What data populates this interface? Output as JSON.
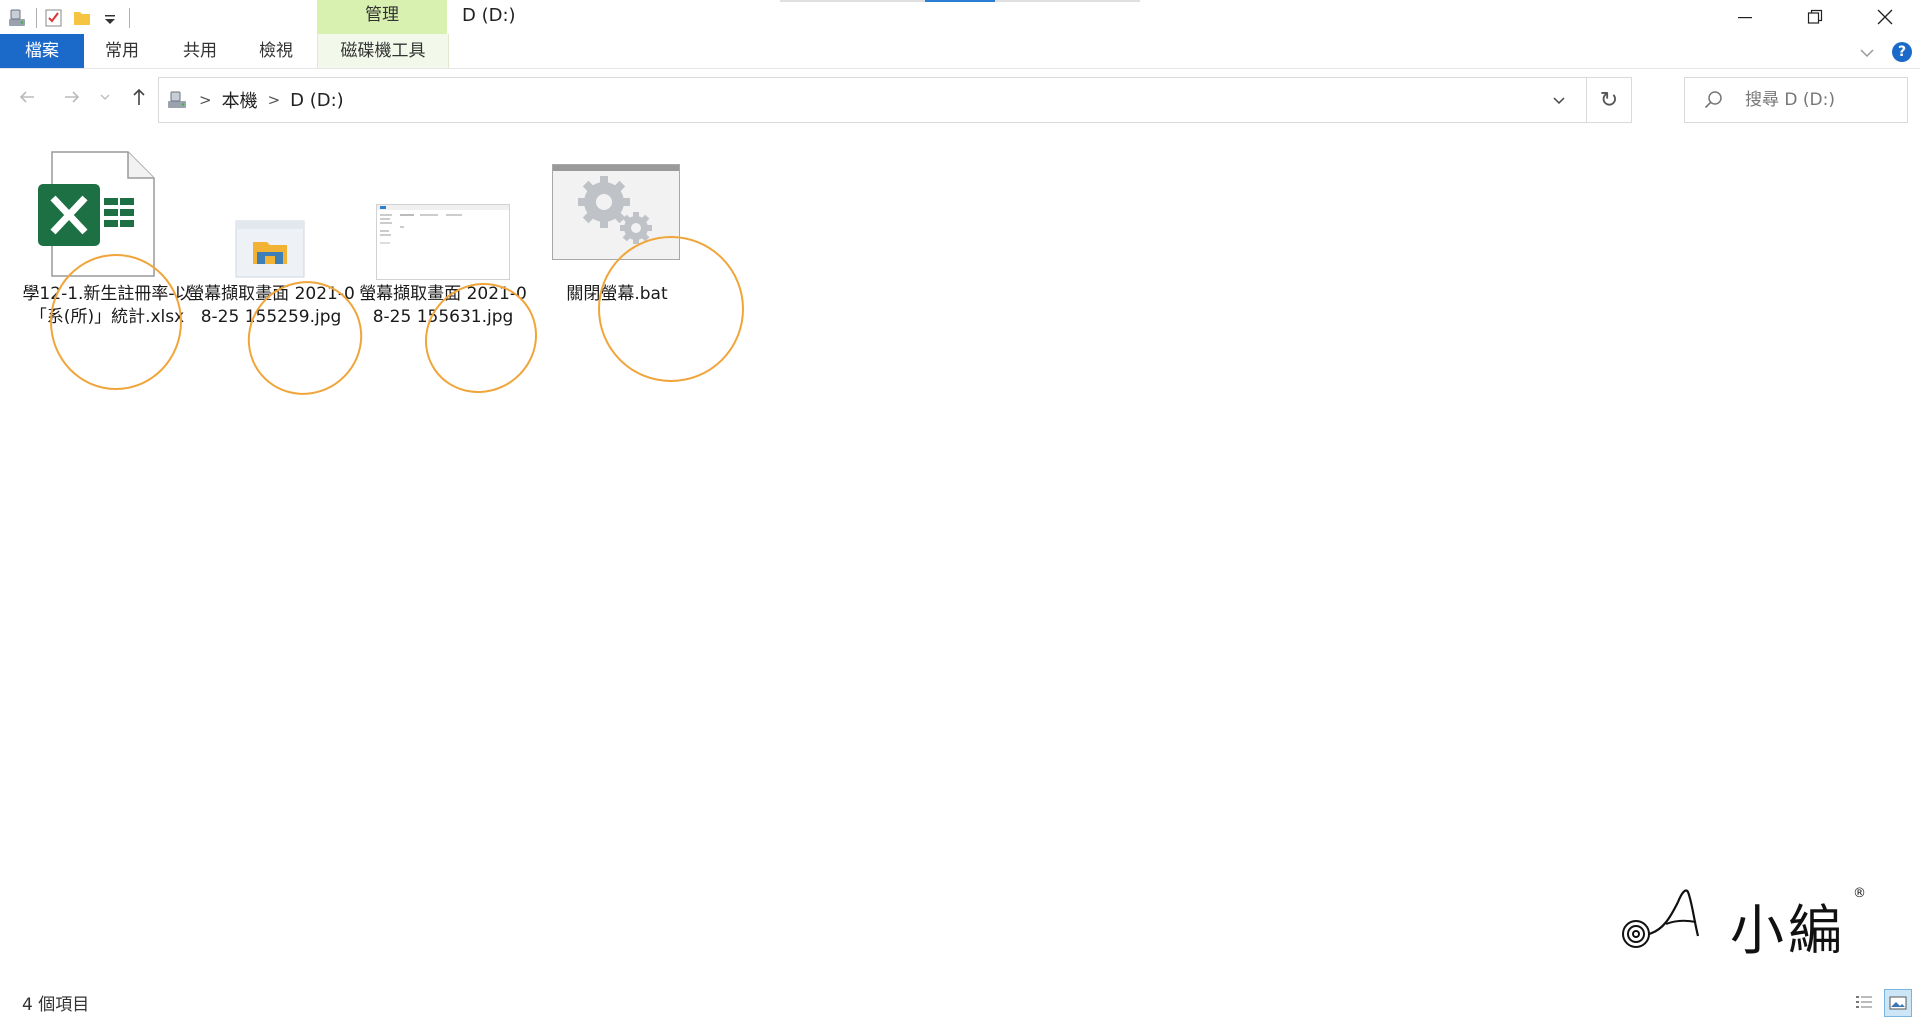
{
  "window": {
    "title": "D (D:)",
    "context_group_label": "管理"
  },
  "quick_access": {
    "icons": [
      "drive-icon",
      "properties-checkmark-icon",
      "new-folder-icon",
      "customize-dropdown-icon"
    ]
  },
  "ribbon": {
    "tabs": [
      {
        "label": "檔案"
      },
      {
        "label": "常用"
      },
      {
        "label": "共用"
      },
      {
        "label": "檢視"
      },
      {
        "label": "磁碟機工具"
      }
    ],
    "help_label": "?"
  },
  "navigation": {
    "breadcrumbs": [
      {
        "label": "本機"
      },
      {
        "label": "D (D:)"
      }
    ],
    "refresh_label": "↻"
  },
  "search": {
    "placeholder": "搜尋 D (D:)"
  },
  "files": [
    {
      "name": "學12-1.新生註冊率-以「系(所)」統計.xlsx",
      "icon": "excel-file-icon",
      "highlighted": true
    },
    {
      "name": "螢幕擷取畫面 2021-08-25 155259.jpg",
      "icon": "image-thumbnail-icon",
      "highlighted": true
    },
    {
      "name": "螢幕擷取畫面 2021-08-25 155631.jpg",
      "icon": "screenshot-thumbnail-icon",
      "highlighted": true
    },
    {
      "name": "關閉螢幕.bat",
      "icon": "batch-gears-icon",
      "highlighted": true
    }
  ],
  "watermark": {
    "text": "小編",
    "mark": "®"
  },
  "status": {
    "item_count": "4 個項目"
  },
  "colors": {
    "file_tab": "#1b6ac9",
    "manage_tab": "#d8f0b0",
    "highlight_circle": "#f0a53a",
    "excel_green": "#1d7044"
  }
}
